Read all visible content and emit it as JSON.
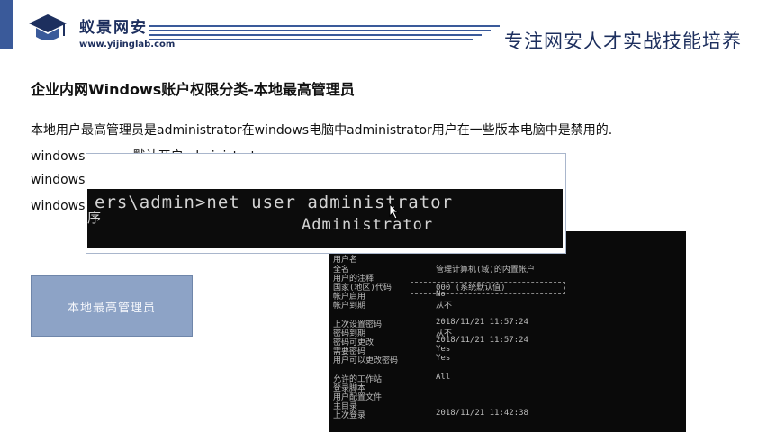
{
  "brand": {
    "name_cn": "蚁景网安",
    "url": "www.yijinglab.com",
    "slogan": "专注网安人才实战技能培养",
    "accent": "#1d2f5e",
    "bar": "#3a5a9a"
  },
  "content": {
    "title": "企业内网Windows账户权限分类-本地最高管理员",
    "p1": "本地用户最高管理员是administrator在windows电脑中administrator用户在一些版本电脑中是禁用的.",
    "p2": "windows server 默认开启administrator",
    "p3": "windows",
    "p4": "windows",
    "badge": "本地最高管理员"
  },
  "cmd": {
    "line1": "ers\\admin>net user administrator",
    "line2": "Administrator",
    "side": "序"
  },
  "output": {
    "rows": [
      {
        "label": "用户名",
        "value": ""
      },
      {
        "label": "全名",
        "value": "管理计算机(域)的内置帐户"
      },
      {
        "label": "用户的注释",
        "value": ""
      },
      {
        "label": "国家(地区)代码",
        "value": "000 (系统默认值)"
      },
      {
        "label": "帐户启用",
        "value": "No"
      },
      {
        "label": "帐户到期",
        "value": "从不"
      },
      {
        "label": "上次设置密码",
        "value": "2018/11/21 11:57:24"
      },
      {
        "label": "密码到期",
        "value": "从不"
      },
      {
        "label": "密码可更改",
        "value": "2018/11/21 11:57:24"
      },
      {
        "label": "需要密码",
        "value": "Yes"
      },
      {
        "label": "用户可以更改密码",
        "value": "Yes"
      },
      {
        "label": "允许的工作站",
        "value": "All"
      },
      {
        "label": "登录脚本",
        "value": ""
      },
      {
        "label": "用户配置文件",
        "value": ""
      },
      {
        "label": "主目录",
        "value": ""
      },
      {
        "label": "上次登录",
        "value": "2018/11/21 11:42:38"
      }
    ]
  }
}
